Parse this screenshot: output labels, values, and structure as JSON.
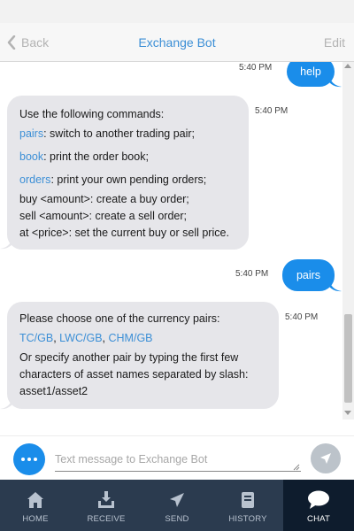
{
  "nav": {
    "back_label": "Back",
    "title": "Exchange Bot",
    "edit_label": "Edit"
  },
  "messages": [
    {
      "id": "m1",
      "direction": "outgoing",
      "text": "help",
      "time": "5:40 PM"
    },
    {
      "id": "m2",
      "direction": "incoming",
      "time": "5:40 PM",
      "lines": [
        "Use the following commands:",
        {
          "link": "pairs",
          "rest": ": switch to another trading pair;"
        },
        {
          "link": "book",
          "rest": ": print the order book;"
        },
        {
          "link": "orders",
          "rest": ": print your own pending orders;"
        },
        "buy <amount>: create a buy order;",
        "sell <amount>: create a sell order;",
        "at <price>: set the current buy or sell price."
      ]
    },
    {
      "id": "m3",
      "direction": "outgoing",
      "text": "pairs",
      "time": "5:40 PM"
    },
    {
      "id": "m4",
      "direction": "incoming",
      "time": "5:40 PM",
      "intro": "Please choose one of the currency pairs:",
      "pairs": [
        "TC/GB",
        "LWC/GB",
        "CHM/GB"
      ],
      "outro_lines": [
        "Or specify another pair by typing the first few",
        "characters of asset names separated by slash:",
        "asset1/asset2"
      ]
    }
  ],
  "composer": {
    "placeholder": "Text message to Exchange Bot",
    "value": ""
  },
  "tabs": [
    {
      "label": "HOME",
      "icon": "home-icon",
      "active": false
    },
    {
      "label": "RECEIVE",
      "icon": "receive-icon",
      "active": false
    },
    {
      "label": "SEND",
      "icon": "send-icon",
      "active": false
    },
    {
      "label": "HISTORY",
      "icon": "history-icon",
      "active": false
    },
    {
      "label": "CHAT",
      "icon": "chat-icon",
      "active": true
    }
  ],
  "colors": {
    "accent": "#1a8dea",
    "link": "#3c8fd6",
    "incoming_bubble": "#e6e6ea",
    "tab_bar": "#2b3b4f",
    "tab_active": "#0e1c2d"
  }
}
